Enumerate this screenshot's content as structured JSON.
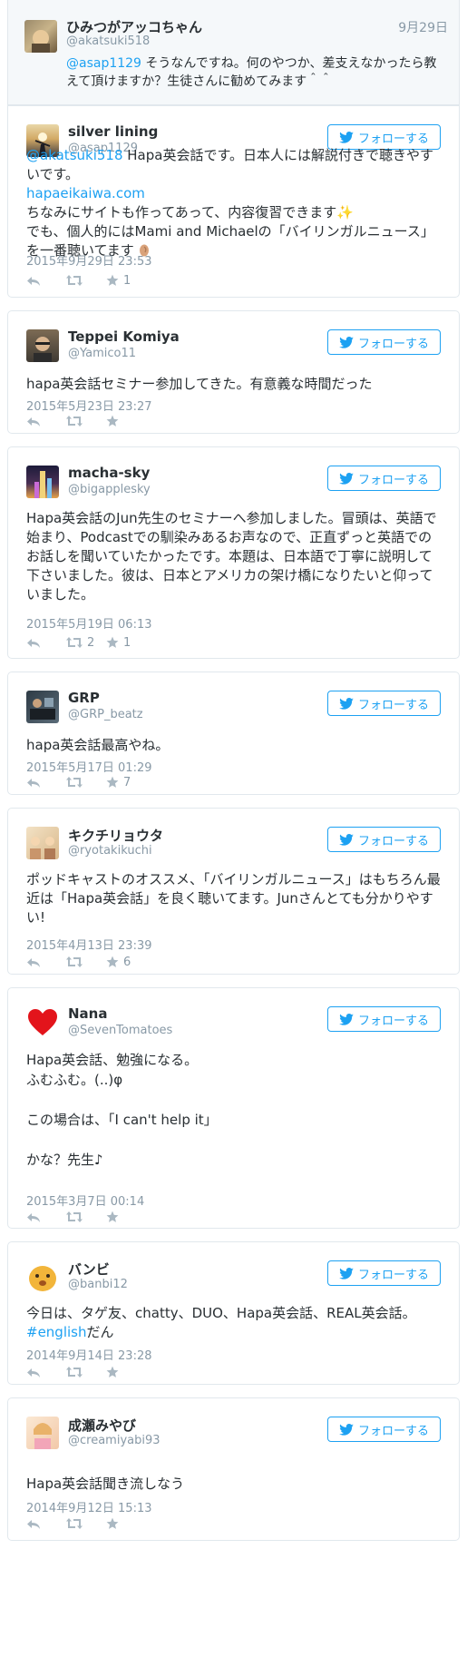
{
  "follow_label": "フォローする",
  "reply": {
    "name": "ひみつがアッコちゃん",
    "handle": "@akatsuki518",
    "date": "9月29日",
    "mention": "@asap1129",
    "text": " そうなんですね。何のやつか、差支えなかったら教えて頂けますか？生徒さんに勧めてみます＾＾"
  },
  "tweets": [
    {
      "name": "silver lining",
      "handle": "@asap1129",
      "mention": "@akatsuki518",
      "text1": " Hapa英会話です。日本人には解説付きで聴きやすいです。",
      "link": "hapaeikaiwa.com",
      "text2": "ちなみにサイトも作ってあって、内容復習できます",
      "text3": "でも、個人的にはMami and Michaelの「バイリンガルニュース」を一番聴いてます",
      "date": "2015年9月29日 23:53",
      "retweets": "",
      "favorites": "1"
    },
    {
      "name": "Teppei Komiya",
      "handle": "@Yamico11",
      "text": "hapa英会話セミナー参加してきた。有意義な時間だった",
      "date": "2015年5月23日 23:27",
      "retweets": "",
      "favorites": ""
    },
    {
      "name": "macha-sky",
      "handle": "@bigapplesky",
      "text": "Hapa英会話のJun先生のセミナーへ参加しました。冒頭は、英語で始まり、Podcastでの馴染みあるお声なので、正直ずっと英語でのお話しを聞いていたかったです。本題は、日本語で丁寧に説明して下さいました。彼は、日本とアメリカの架け橋になりたいと仰っていました。",
      "date": "2015年5月19日 06:13",
      "retweets": "2",
      "favorites": "1"
    },
    {
      "name": "GRP",
      "handle": "@GRP_beatz",
      "text": "hapa英会話最高やね。",
      "date": "2015年5月17日 01:29",
      "retweets": "",
      "favorites": "7"
    },
    {
      "name": "キクチリョウタ",
      "handle": "@ryotakikuchi",
      "text": "ポッドキャストのオススメ、「バイリンガルニュース」はもちろん最近は「Hapa英会話」を良く聴いてます。Junさんとても分かりやすい!",
      "date": "2015年4月13日 23:39",
      "retweets": "",
      "favorites": "6"
    },
    {
      "name": "Nana",
      "handle": "@SevenTomatoes",
      "text": "Hapa英会話、勉強になる。\nふむふむ。(..)φ\n\nこの場合は、「I can't help it」\n\nかな？先生♪",
      "date": "2015年3月7日 00:14",
      "retweets": "",
      "favorites": ""
    },
    {
      "name": "バンビ",
      "handle": "@banbi12",
      "text": "今日は、タゲ友、chatty、DUO、Hapa英会話、REAL英会話。",
      "hashtag": "#english",
      "text_after": "だん",
      "date": "2014年9月14日 23:28",
      "retweets": "",
      "favorites": ""
    },
    {
      "name": "成瀬みやび",
      "handle": "@creamiyabi93",
      "text": "Hapa英会話聞き流しなう",
      "date": "2014年9月12日 15:13",
      "retweets": "",
      "favorites": ""
    }
  ]
}
